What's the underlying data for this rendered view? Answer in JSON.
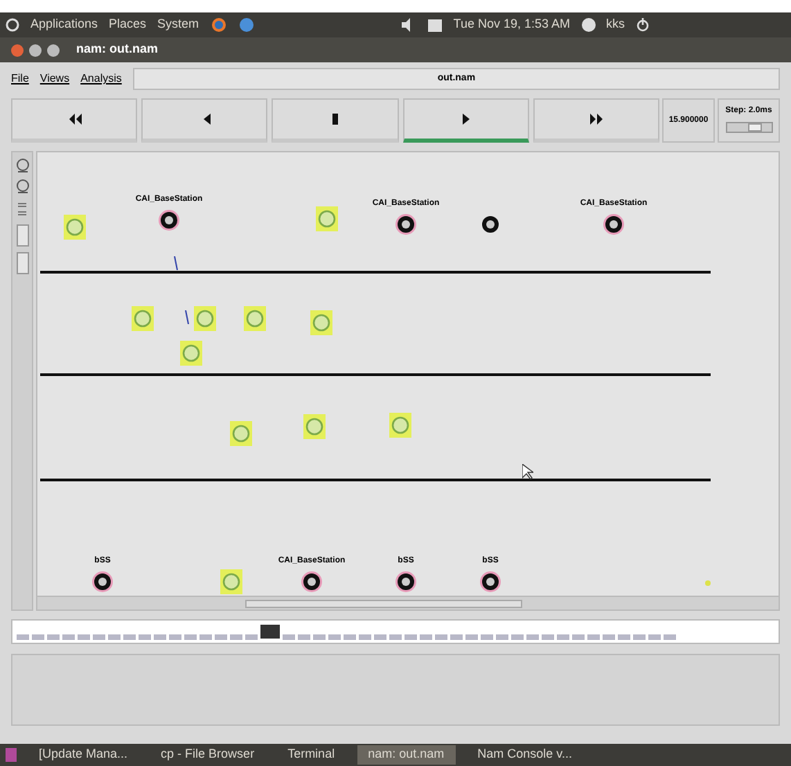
{
  "top_panel": {
    "menus": [
      "Applications",
      "Places",
      "System"
    ],
    "clock": "Tue Nov 19, 1:53 AM",
    "user": "kks"
  },
  "window": {
    "title": "nam: out.nam"
  },
  "menu": [
    "File",
    "Views",
    "Analysis"
  ],
  "file_label": "out.nam",
  "controls": [
    {
      "kind": "rewind",
      "selected": false
    },
    {
      "kind": "back",
      "selected": false
    },
    {
      "kind": "stop",
      "selected": false
    },
    {
      "kind": "play",
      "selected": true
    },
    {
      "kind": "forward",
      "selected": false
    }
  ],
  "time": "15.900000",
  "step": "Step: 2.0ms",
  "step_slider": {
    "level": 0.7
  },
  "nodes": [
    {
      "kind": "mobile"
    },
    {
      "kind": "base",
      "label": "CAI_BaseStation"
    },
    {
      "kind": "mobile"
    },
    {
      "kind": "base",
      "label": "CAI_BaseStation"
    },
    {
      "kind": "plain"
    },
    {
      "kind": "base",
      "label": "CAI_BaseStation"
    },
    {
      "kind": "mobile"
    },
    {
      "kind": "mobile"
    },
    {
      "kind": "mobile"
    },
    {
      "kind": "mobile"
    },
    {
      "kind": "mobile"
    },
    {
      "kind": "mobile"
    },
    {
      "kind": "mobile"
    },
    {
      "kind": "mobile"
    },
    {
      "kind": "base",
      "label": "bSS"
    },
    {
      "kind": "mobile"
    },
    {
      "kind": "base",
      "label": "CAI_BaseStation"
    },
    {
      "kind": "base",
      "label": "bSS"
    },
    {
      "kind": "base",
      "label": "bSS"
    }
  ],
  "taskbar": [
    {
      "label": "[Update Mana...",
      "selected": false
    },
    {
      "label": "cp - File Browser",
      "selected": false
    },
    {
      "label": "Terminal",
      "selected": false
    },
    {
      "label": "nam: out.nam",
      "selected": true
    },
    {
      "label": "Nam Console v...",
      "selected": false
    }
  ]
}
